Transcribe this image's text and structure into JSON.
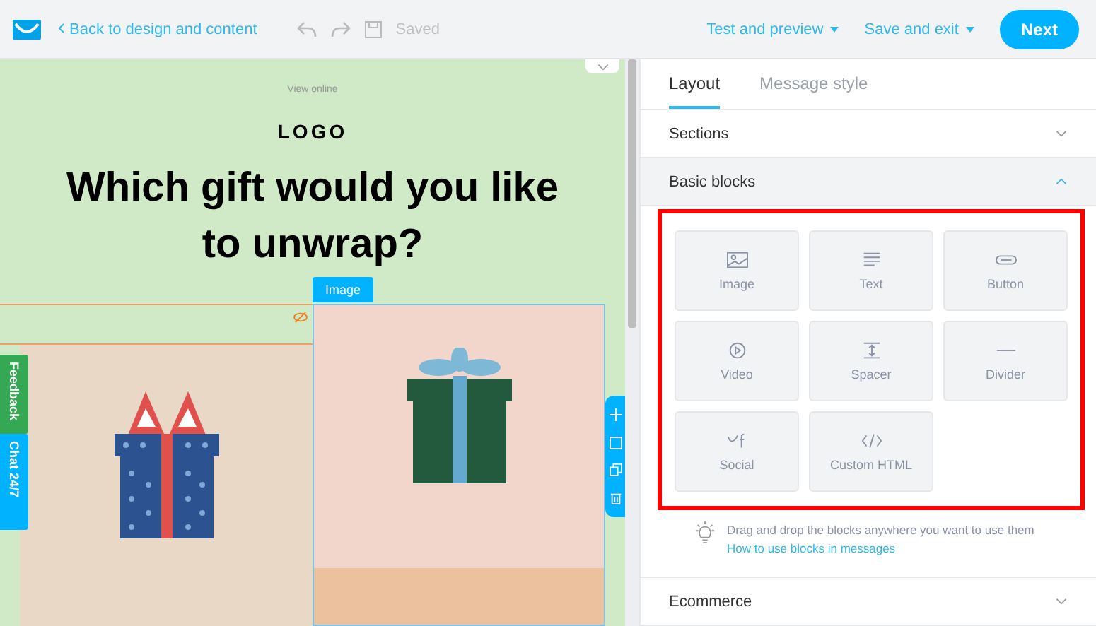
{
  "topbar": {
    "back_link": "Back to design and content",
    "saved_label": "Saved",
    "menus": [
      {
        "label": "Test and preview"
      },
      {
        "label": "Save and exit"
      }
    ],
    "next_button": "Next"
  },
  "canvas": {
    "view_online": "View online",
    "logo": "LOGO",
    "heading": "Which gift would you like to unwrap?",
    "selected_block_label": "Image",
    "side_tabs": [
      {
        "label": "Feedback",
        "kind": "feedback"
      },
      {
        "label": "Chat 24/7",
        "kind": "chat"
      }
    ]
  },
  "panel": {
    "tabs": [
      {
        "label": "Layout",
        "selected": true
      },
      {
        "label": "Message style",
        "selected": false
      }
    ],
    "sections": [
      {
        "title": "Sections",
        "expanded": false
      },
      {
        "title": "Basic blocks",
        "expanded": true
      }
    ],
    "blocks": [
      {
        "label": "Image",
        "kind": "image"
      },
      {
        "label": "Text",
        "kind": "text"
      },
      {
        "label": "Button",
        "kind": "button"
      },
      {
        "label": "Video",
        "kind": "video"
      },
      {
        "label": "Spacer",
        "kind": "spacer"
      },
      {
        "label": "Divider",
        "kind": "divider"
      },
      {
        "label": "Social",
        "kind": "social"
      },
      {
        "label": "Custom HTML",
        "kind": "html"
      }
    ],
    "hint": "Drag and drop the blocks anywhere you want to use them",
    "hint_link": "How to use blocks in messages",
    "bottom_sections": [
      {
        "title": "Ecommerce",
        "expanded": false
      }
    ]
  }
}
